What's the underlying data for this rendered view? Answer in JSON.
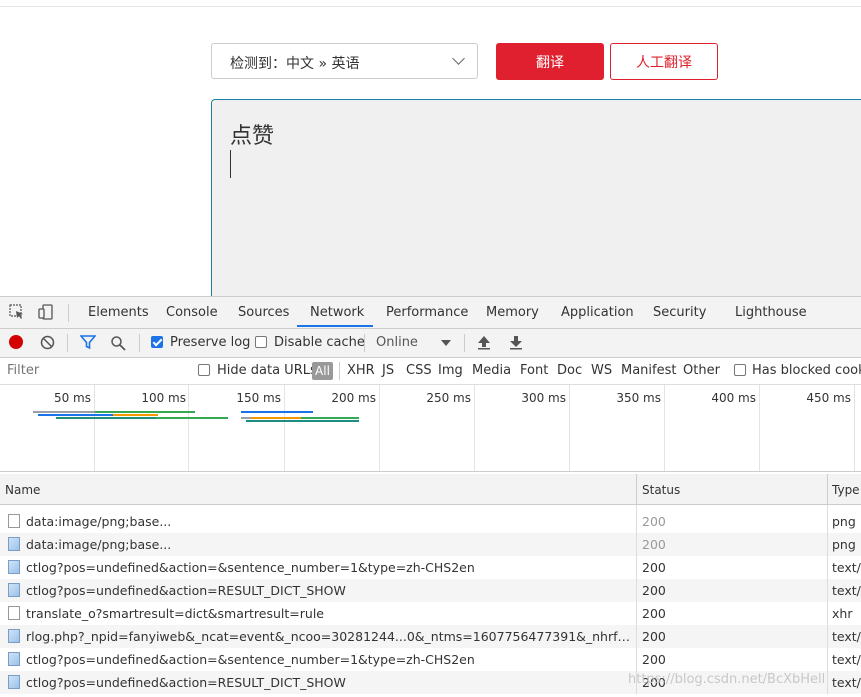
{
  "translator": {
    "lang_select": "检测到：中文 » 英语",
    "translate_button": "翻译",
    "human_button": "人工翻译",
    "input_text": "点赞"
  },
  "devtools": {
    "tabs": [
      "Elements",
      "Console",
      "Sources",
      "Network",
      "Performance",
      "Memory",
      "Application",
      "Security",
      "Lighthouse"
    ],
    "active_tab": "Network",
    "toolbar": {
      "preserve_log": "Preserve log",
      "preserve_log_checked": true,
      "disable_cache": "Disable cache",
      "disable_cache_checked": false,
      "throttle": "Online"
    },
    "filter": {
      "placeholder": "Filter",
      "hide_data_urls": "Hide data URLs",
      "all": "All",
      "types": [
        "XHR",
        "JS",
        "CSS",
        "Img",
        "Media",
        "Font",
        "Doc",
        "WS",
        "Manifest",
        "Other"
      ],
      "has_blocked": "Has blocked cookie"
    },
    "timeline_ticks": [
      "50 ms",
      "100 ms",
      "150 ms",
      "200 ms",
      "250 ms",
      "300 ms",
      "350 ms",
      "400 ms",
      "450 ms"
    ],
    "columns": {
      "name": "Name",
      "status": "Status",
      "type": "Type"
    },
    "rows": [
      {
        "name": "data:image/png;base...",
        "status": "200",
        "type": "png",
        "muted": true,
        "icon": "blank"
      },
      {
        "name": "data:image/png;base...",
        "status": "200",
        "type": "png",
        "muted": true,
        "icon": "img"
      },
      {
        "name": "ctlog?pos=undefined&action=&sentence_number=1&type=zh-CHS2en",
        "status": "200",
        "type": "text/",
        "muted": false,
        "icon": "img"
      },
      {
        "name": "ctlog?pos=undefined&action=RESULT_DICT_SHOW",
        "status": "200",
        "type": "text/",
        "muted": false,
        "icon": "img"
      },
      {
        "name": "translate_o?smartresult=dict&smartresult=rule",
        "status": "200",
        "type": "xhr",
        "muted": false,
        "icon": "blank"
      },
      {
        "name": "rlog.php?_npid=fanyiweb&_ncat=event&_ncoo=30281244...0&_ntms=1607756477391&_nhrf=newwe...",
        "status": "200",
        "type": "text/",
        "muted": false,
        "icon": "img"
      },
      {
        "name": "ctlog?pos=undefined&action=&sentence_number=1&type=zh-CHS2en",
        "status": "200",
        "type": "text/",
        "muted": false,
        "icon": "img"
      },
      {
        "name": "ctlog?pos=undefined&action=RESULT_DICT_SHOW",
        "status": "200",
        "type": "text/",
        "muted": false,
        "icon": "img"
      }
    ]
  },
  "watermark": "https://blog.csdn.net/BcXbHell"
}
